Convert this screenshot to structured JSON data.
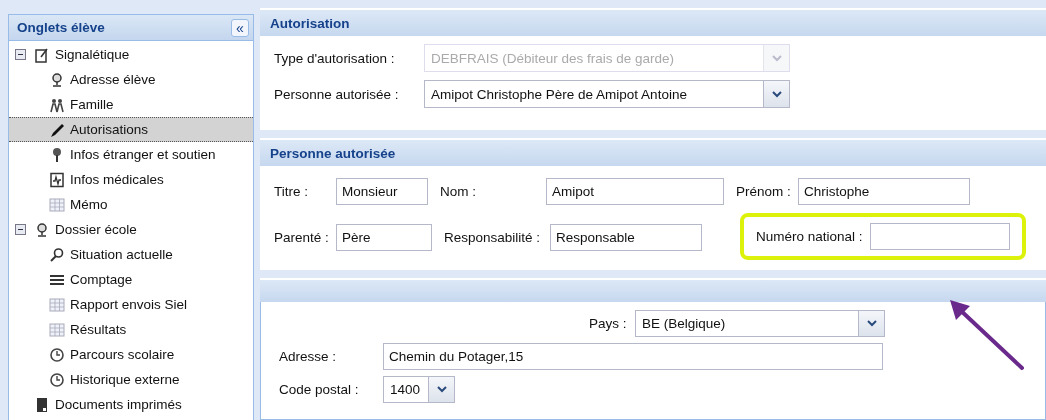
{
  "sidebar": {
    "title": "Onglets élève",
    "collapse_button": "«",
    "tree": [
      {
        "label": "Signalétique",
        "expanded": true,
        "selected": false,
        "children": [
          {
            "label": "Adresse élève",
            "selected": false
          },
          {
            "label": "Famille",
            "selected": false
          },
          {
            "label": "Autorisations",
            "selected": true
          },
          {
            "label": "Infos étranger et soutien",
            "selected": false
          },
          {
            "label": "Infos médicales",
            "selected": false
          },
          {
            "label": "Mémo",
            "selected": false
          }
        ]
      },
      {
        "label": "Dossier école",
        "expanded": true,
        "selected": false,
        "children": [
          {
            "label": "Situation actuelle",
            "selected": false
          },
          {
            "label": "Comptage",
            "selected": false
          },
          {
            "label": "Rapport envois Siel",
            "selected": false
          },
          {
            "label": "Résultats",
            "selected": false
          },
          {
            "label": "Parcours scolaire",
            "selected": false
          },
          {
            "label": "Historique externe",
            "selected": false
          }
        ]
      },
      {
        "label": "Documents imprimés",
        "selected": false
      }
    ]
  },
  "authorization": {
    "title": "Autorisation",
    "fields": [
      {
        "label": "Type d'autorisation :",
        "value": "DEBFRAIS (Débiteur des frais de garde)",
        "disabled": true
      },
      {
        "label": "Personne autorisée :",
        "value": "Amipot Christophe Père de Amipot Antoine",
        "disabled": false
      }
    ]
  },
  "authorized_person": {
    "title": "Personne autorisée",
    "rows": [
      [
        {
          "label": "Titre :",
          "value": "Monsieur",
          "highlighted": false
        },
        {
          "label": "Nom :",
          "value": "Amipot",
          "highlighted": false
        },
        {
          "label": "Prénom :",
          "value": "Christophe",
          "highlighted": false
        }
      ],
      [
        {
          "label": "Parenté :",
          "value": "Père",
          "highlighted": false
        },
        {
          "label": "Responsabilité :",
          "value": "Responsable",
          "highlighted": false
        },
        {
          "label": "Numéro national :",
          "highlighted": true
        }
      ]
    ]
  },
  "address": {
    "fields": [
      {
        "kind": "combo",
        "label": "Pays :",
        "value": "BE (Belgique)"
      },
      {
        "kind": "text",
        "label": "Adresse :",
        "value": "Chemin du Potager,15"
      },
      {
        "kind": "combo",
        "label": "Code postal :",
        "value": "1400"
      }
    ]
  }
}
